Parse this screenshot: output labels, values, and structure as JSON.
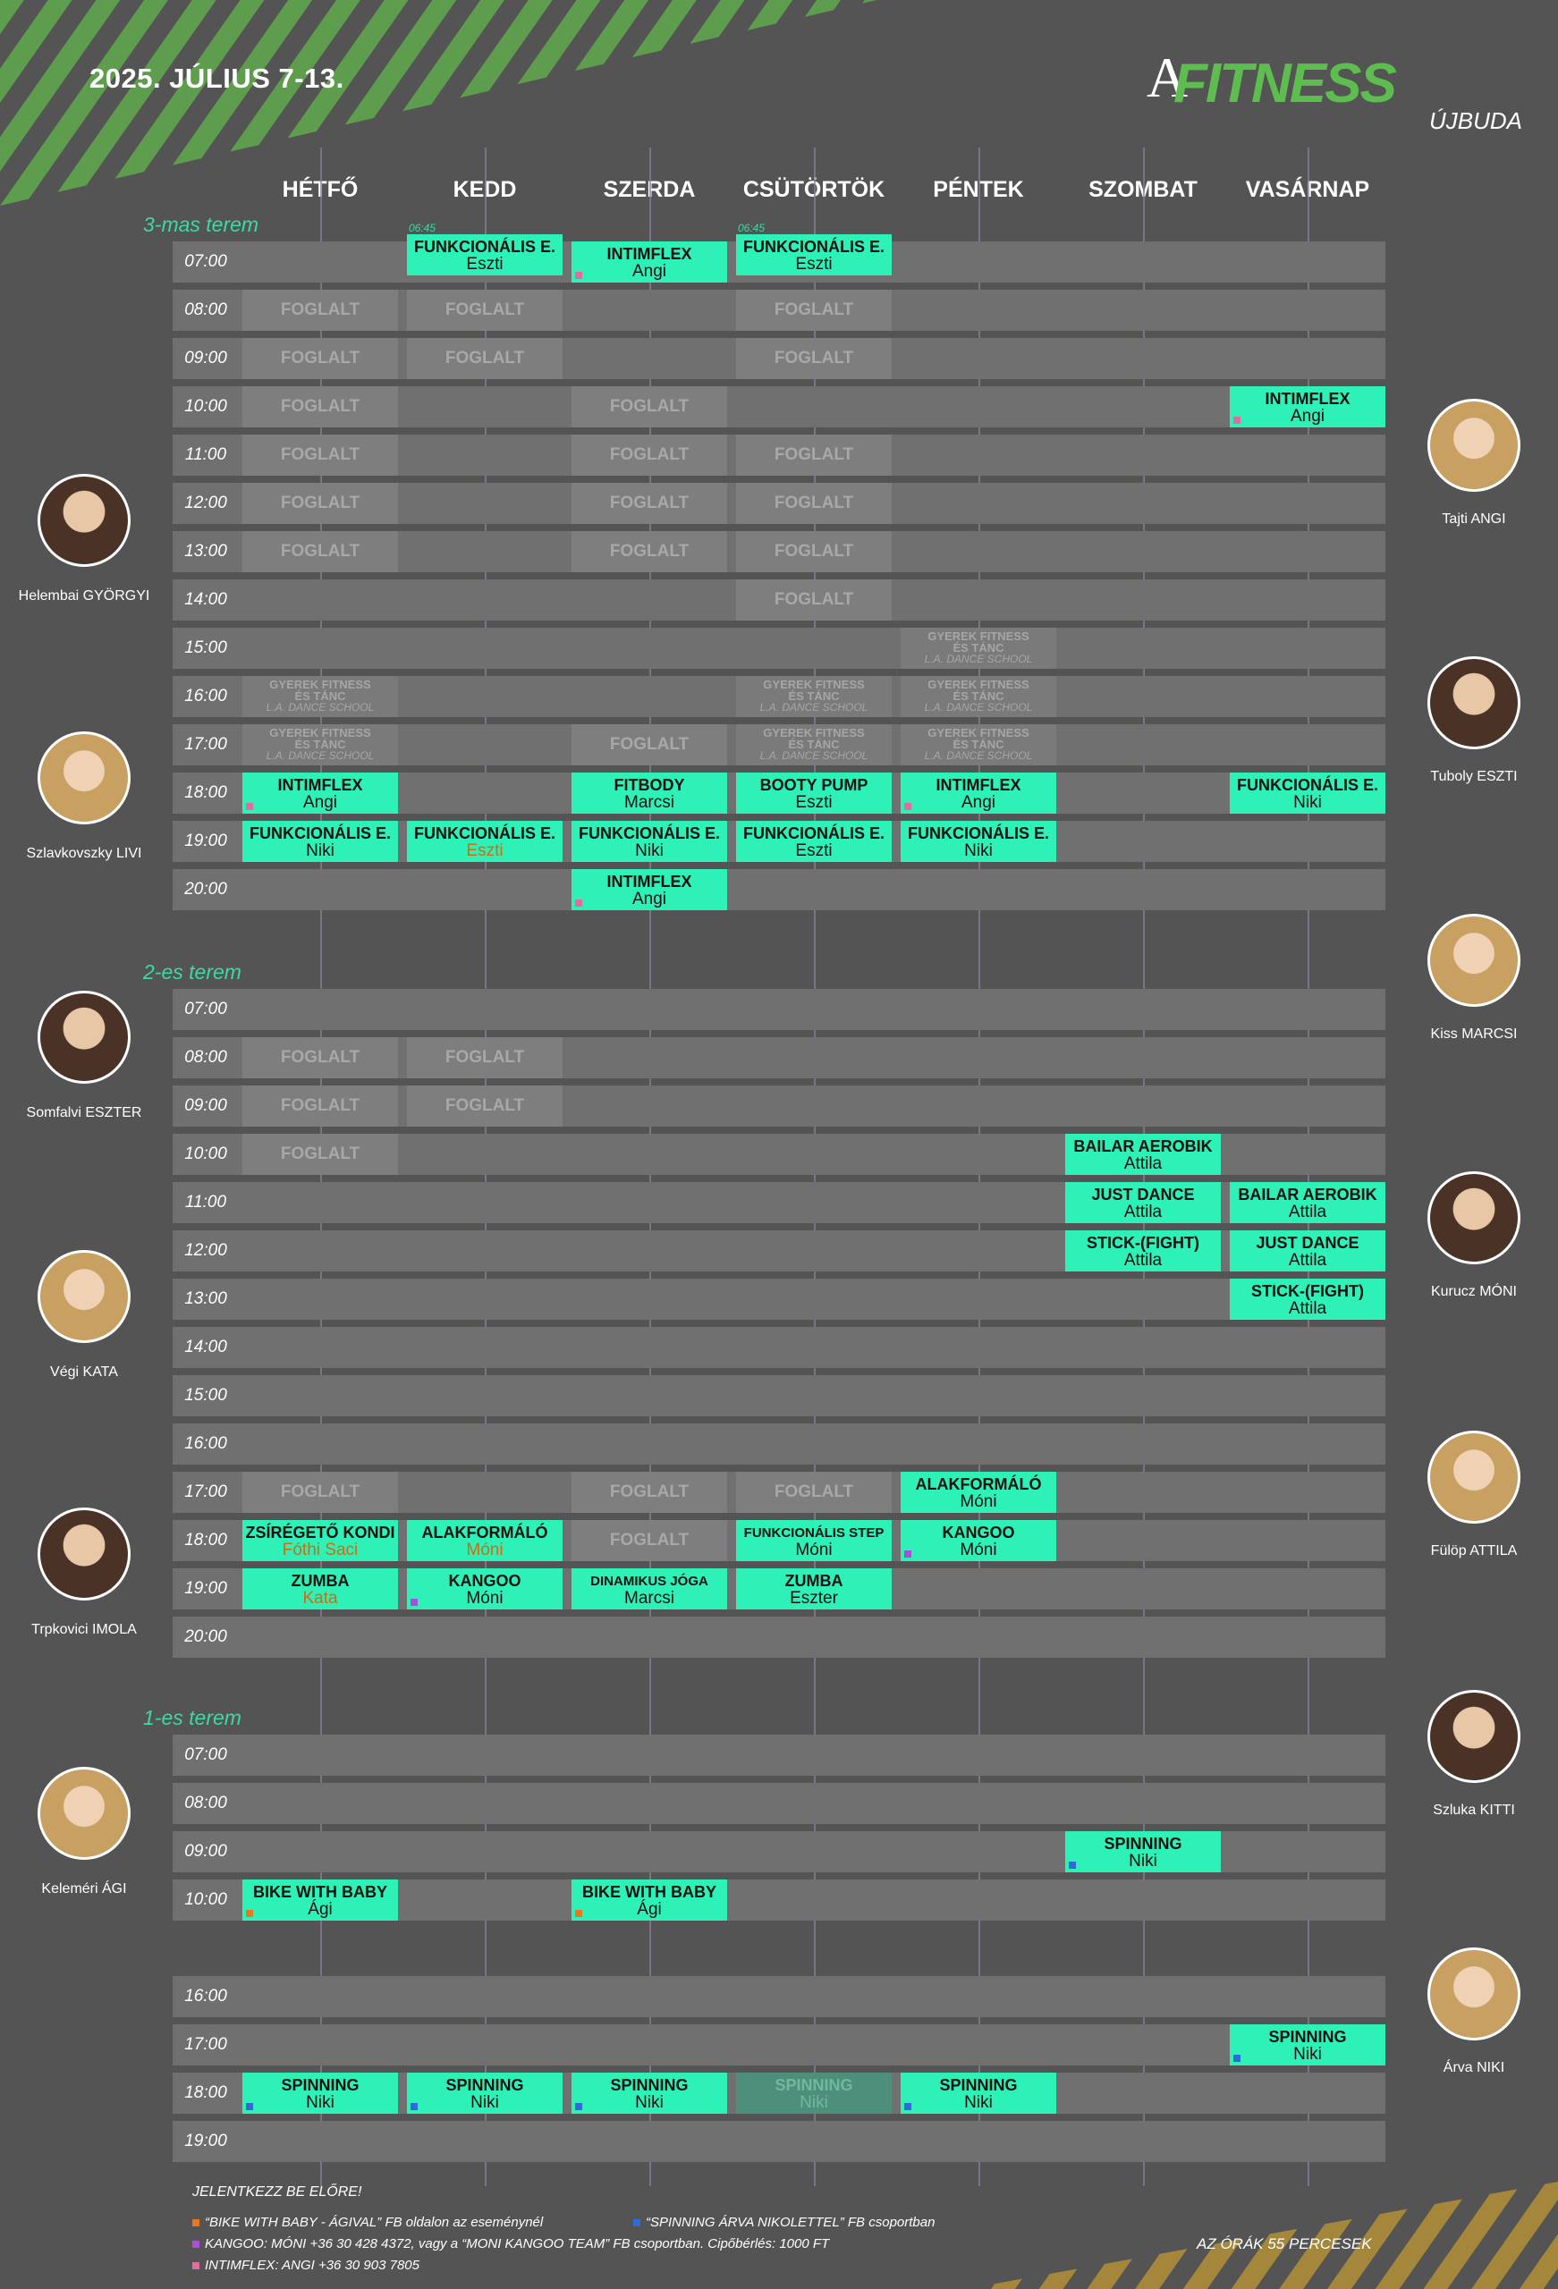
{
  "title": "2025. JÚLIUS 7-13.",
  "logo": {
    "mark": "A",
    "name": "FITNESS",
    "location": "ÚJBUDA"
  },
  "days": [
    "HÉTFŐ",
    "KEDD",
    "SZERDA",
    "CSÜTÖRTÖK",
    "PÉNTEK",
    "SZOMBAT",
    "VASÁRNAP"
  ],
  "colors": {
    "class": "#2ef1b8",
    "busy": "#7e7e7e",
    "accent": "#3dd9a3",
    "logo": "#5dbe4f",
    "baby": "#e8781e",
    "spinning": "#2d6bd6",
    "kangoo": "#a94fd8",
    "intimflex": "#e56aa0"
  },
  "rooms": [
    {
      "name": "3-mas terem",
      "times": [
        "07:00",
        "08:00",
        "09:00",
        "10:00",
        "11:00",
        "12:00",
        "13:00",
        "14:00",
        "15:00",
        "16:00",
        "17:00",
        "18:00",
        "19:00",
        "20:00"
      ],
      "cells": [
        {
          "d": 1,
          "r": 0,
          "k": "cls",
          "n": "FUNKCIONÁLIS E.",
          "t": "Eszti",
          "off": -1,
          "pre": "06:45"
        },
        {
          "d": 2,
          "r": 0,
          "k": "cls",
          "n": "INTIMFLEX",
          "t": "Angi",
          "m": "intimflex"
        },
        {
          "d": 3,
          "r": 0,
          "k": "cls",
          "n": "FUNKCIONÁLIS E.",
          "t": "Eszti",
          "off": -1,
          "pre": "06:45"
        },
        {
          "d": 0,
          "r": 1,
          "k": "busy",
          "n": "FOGLALT"
        },
        {
          "d": 1,
          "r": 1,
          "k": "busy",
          "n": "FOGLALT"
        },
        {
          "d": 3,
          "r": 1,
          "k": "busy",
          "n": "FOGLALT"
        },
        {
          "d": 0,
          "r": 2,
          "k": "busy",
          "n": "FOGLALT"
        },
        {
          "d": 1,
          "r": 2,
          "k": "busy",
          "n": "FOGLALT"
        },
        {
          "d": 3,
          "r": 2,
          "k": "busy",
          "n": "FOGLALT"
        },
        {
          "d": 0,
          "r": 3,
          "k": "busy",
          "n": "FOGLALT"
        },
        {
          "d": 2,
          "r": 3,
          "k": "busy",
          "n": "FOGLALT"
        },
        {
          "d": 6,
          "r": 3,
          "k": "cls",
          "n": "INTIMFLEX",
          "t": "Angi",
          "m": "intimflex"
        },
        {
          "d": 0,
          "r": 4,
          "k": "busy",
          "n": "FOGLALT"
        },
        {
          "d": 2,
          "r": 4,
          "k": "busy",
          "n": "FOGLALT"
        },
        {
          "d": 3,
          "r": 4,
          "k": "busy",
          "n": "FOGLALT"
        },
        {
          "d": 0,
          "r": 5,
          "k": "busy",
          "n": "FOGLALT"
        },
        {
          "d": 2,
          "r": 5,
          "k": "busy",
          "n": "FOGLALT"
        },
        {
          "d": 3,
          "r": 5,
          "k": "busy",
          "n": "FOGLALT"
        },
        {
          "d": 0,
          "r": 6,
          "k": "busy",
          "n": "FOGLALT"
        },
        {
          "d": 2,
          "r": 6,
          "k": "busy",
          "n": "FOGLALT"
        },
        {
          "d": 3,
          "r": 6,
          "k": "busy",
          "n": "FOGLALT"
        },
        {
          "d": 3,
          "r": 7,
          "k": "busy",
          "n": "FOGLALT"
        },
        {
          "d": 4,
          "r": 8,
          "k": "kid",
          "n": "GYEREK FITNESS",
          "t": "ÉS TÁNC",
          "s": "L.A. DANCE SCHOOL"
        },
        {
          "d": 0,
          "r": 9,
          "k": "kid",
          "n": "GYEREK FITNESS",
          "t": "ÉS TÁNC",
          "s": "L.A. DANCE SCHOOL"
        },
        {
          "d": 3,
          "r": 9,
          "k": "kid",
          "n": "GYEREK FITNESS",
          "t": "ÉS TÁNC",
          "s": "L.A. DANCE SCHOOL"
        },
        {
          "d": 4,
          "r": 9,
          "k": "kid",
          "n": "GYEREK FITNESS",
          "t": "ÉS TÁNC",
          "s": "L.A. DANCE SCHOOL"
        },
        {
          "d": 0,
          "r": 10,
          "k": "kid",
          "n": "GYEREK FITNESS",
          "t": "ÉS TÁNC",
          "s": "L.A. DANCE SCHOOL"
        },
        {
          "d": 2,
          "r": 10,
          "k": "busy",
          "n": "FOGLALT"
        },
        {
          "d": 3,
          "r": 10,
          "k": "kid",
          "n": "GYEREK FITNESS",
          "t": "ÉS TÁNC",
          "s": "L.A. DANCE SCHOOL"
        },
        {
          "d": 4,
          "r": 10,
          "k": "kid",
          "n": "GYEREK FITNESS",
          "t": "ÉS TÁNC",
          "s": "L.A. DANCE SCHOOL"
        },
        {
          "d": 0,
          "r": 11,
          "k": "cls",
          "n": "INTIMFLEX",
          "t": "Angi",
          "m": "intimflex"
        },
        {
          "d": 2,
          "r": 11,
          "k": "cls",
          "n": "FITBODY",
          "t": "Marcsi"
        },
        {
          "d": 3,
          "r": 11,
          "k": "cls",
          "n": "BOOTY PUMP",
          "t": "Eszti"
        },
        {
          "d": 4,
          "r": 11,
          "k": "cls",
          "n": "INTIMFLEX",
          "t": "Angi",
          "m": "intimflex"
        },
        {
          "d": 6,
          "r": 11,
          "k": "cls",
          "n": "FUNKCIONÁLIS E.",
          "t": "Niki"
        },
        {
          "d": 0,
          "r": 12,
          "k": "cls",
          "n": "FUNKCIONÁLIS E.",
          "t": "Niki"
        },
        {
          "d": 1,
          "r": 12,
          "k": "cls",
          "n": "FUNKCIONÁLIS E.",
          "t": "Eszti",
          "o": true
        },
        {
          "d": 2,
          "r": 12,
          "k": "cls",
          "n": "FUNKCIONÁLIS E.",
          "t": "Niki"
        },
        {
          "d": 3,
          "r": 12,
          "k": "cls",
          "n": "FUNKCIONÁLIS E.",
          "t": "Eszti"
        },
        {
          "d": 4,
          "r": 12,
          "k": "cls",
          "n": "FUNKCIONÁLIS E.",
          "t": "Niki"
        },
        {
          "d": 2,
          "r": 13,
          "k": "cls",
          "n": "INTIMFLEX",
          "t": "Angi",
          "m": "intimflex"
        }
      ]
    },
    {
      "name": "2-es terem",
      "times": [
        "07:00",
        "08:00",
        "09:00",
        "10:00",
        "11:00",
        "12:00",
        "13:00",
        "14:00",
        "15:00",
        "16:00",
        "17:00",
        "18:00",
        "19:00",
        "20:00"
      ],
      "cells": [
        {
          "d": 0,
          "r": 1,
          "k": "busy",
          "n": "FOGLALT"
        },
        {
          "d": 1,
          "r": 1,
          "k": "busy",
          "n": "FOGLALT"
        },
        {
          "d": 0,
          "r": 2,
          "k": "busy",
          "n": "FOGLALT"
        },
        {
          "d": 1,
          "r": 2,
          "k": "busy",
          "n": "FOGLALT"
        },
        {
          "d": 0,
          "r": 3,
          "k": "busy",
          "n": "FOGLALT"
        },
        {
          "d": 5,
          "r": 3,
          "k": "cls",
          "n": "BAILAR AEROBIK",
          "t": "Attila"
        },
        {
          "d": 5,
          "r": 4,
          "k": "cls",
          "n": "JUST DANCE",
          "t": "Attila"
        },
        {
          "d": 6,
          "r": 4,
          "k": "cls",
          "n": "BAILAR AEROBIK",
          "t": "Attila"
        },
        {
          "d": 5,
          "r": 5,
          "k": "cls",
          "n": "STICK-(FIGHT)",
          "t": "Attila"
        },
        {
          "d": 6,
          "r": 5,
          "k": "cls",
          "n": "JUST DANCE",
          "t": "Attila"
        },
        {
          "d": 6,
          "r": 6,
          "k": "cls",
          "n": "STICK-(FIGHT)",
          "t": "Attila"
        },
        {
          "d": 0,
          "r": 10,
          "k": "busy",
          "n": "FOGLALT"
        },
        {
          "d": 2,
          "r": 10,
          "k": "busy",
          "n": "FOGLALT"
        },
        {
          "d": 3,
          "r": 10,
          "k": "busy",
          "n": "FOGLALT"
        },
        {
          "d": 4,
          "r": 10,
          "k": "cls",
          "n": "ALAKFORMÁLÓ",
          "t": "Móni"
        },
        {
          "d": 0,
          "r": 11,
          "k": "cls",
          "n": "ZSÍRÉGETŐ KONDI",
          "t": "Fóthi Saci",
          "o": true
        },
        {
          "d": 1,
          "r": 11,
          "k": "cls",
          "n": "ALAKFORMÁLÓ",
          "t": "Móni",
          "o": true
        },
        {
          "d": 2,
          "r": 11,
          "k": "busy",
          "n": "FOGLALT"
        },
        {
          "d": 3,
          "r": 11,
          "k": "cls",
          "n": "FUNKCIONÁLIS STEP",
          "t": "Móni",
          "sm": true
        },
        {
          "d": 4,
          "r": 11,
          "k": "cls",
          "n": "KANGOO",
          "t": "Móni",
          "m": "kangoo"
        },
        {
          "d": 0,
          "r": 12,
          "k": "cls",
          "n": "ZUMBA",
          "t": "Kata",
          "o": true
        },
        {
          "d": 1,
          "r": 12,
          "k": "cls",
          "n": "KANGOO",
          "t": "Móni",
          "m": "kangoo"
        },
        {
          "d": 2,
          "r": 12,
          "k": "cls",
          "n": "DINAMIKUS JÓGA",
          "t": "Marcsi",
          "sm": true
        },
        {
          "d": 3,
          "r": 12,
          "k": "cls",
          "n": "ZUMBA",
          "t": "Eszter"
        }
      ]
    },
    {
      "name": "1-es terem",
      "times": [
        "07:00",
        "08:00",
        "09:00",
        "10:00",
        "",
        "16:00",
        "17:00",
        "18:00",
        "19:00"
      ],
      "cells": [
        {
          "d": 5,
          "r": 2,
          "k": "cls",
          "n": "SPINNING",
          "t": "Niki",
          "m": "spinning"
        },
        {
          "d": 0,
          "r": 3,
          "k": "cls",
          "n": "BIKE WITH BABY",
          "t": "Ági",
          "m": "baby"
        },
        {
          "d": 2,
          "r": 3,
          "k": "cls",
          "n": "BIKE WITH BABY",
          "t": "Ági",
          "m": "baby"
        },
        {
          "d": 6,
          "r": 6,
          "k": "cls",
          "n": "SPINNING",
          "t": "Niki",
          "m": "spinning"
        },
        {
          "d": 0,
          "r": 7,
          "k": "cls",
          "n": "SPINNING",
          "t": "Niki",
          "m": "spinning"
        },
        {
          "d": 1,
          "r": 7,
          "k": "cls",
          "n": "SPINNING",
          "t": "Niki",
          "m": "spinning"
        },
        {
          "d": 2,
          "r": 7,
          "k": "cls",
          "n": "SPINNING",
          "t": "Niki",
          "m": "spinning"
        },
        {
          "d": 3,
          "r": 7,
          "k": "cls",
          "n": "SPINNING",
          "t": "Niki",
          "f": true
        },
        {
          "d": 4,
          "r": 7,
          "k": "cls",
          "n": "SPINNING",
          "t": "Niki",
          "m": "spinning"
        }
      ]
    }
  ],
  "instructors_left": [
    "Helembai GYÖRGYI",
    "Szlavkovszky LIVI",
    "Somfalvi ESZTER",
    "Végi KATA",
    "Trpkovici IMOLA",
    "Keleméri ÁGI"
  ],
  "instructors_right": [
    "Tajti ANGI",
    "Tuboly ESZTI",
    "Kiss MARCSI",
    "Kurucz MÓNI",
    "Fülöp ATTILA",
    "Szluka KITTI",
    "Árva NIKI"
  ],
  "footer": {
    "heading": "JELENTKEZZ BE ELŐRE!",
    "note_baby": "“BIKE WITH BABY - ÁGIVAL” FB oldalon az eseménynél",
    "note_spinning": "“SPINNING ÁRVA NIKOLETTEL” FB csoportban",
    "note_kangoo": "KANGOO: MÓNI +36 30 428 4372, vagy a “MONI KANGOO TEAM” FB csoportban. Cipőbérlés: 1000 FT",
    "note_intimflex": "INTIMFLEX: ANGI +36 30 903 7805",
    "duration": "AZ ÓRÁK 55 PERCESEK"
  }
}
